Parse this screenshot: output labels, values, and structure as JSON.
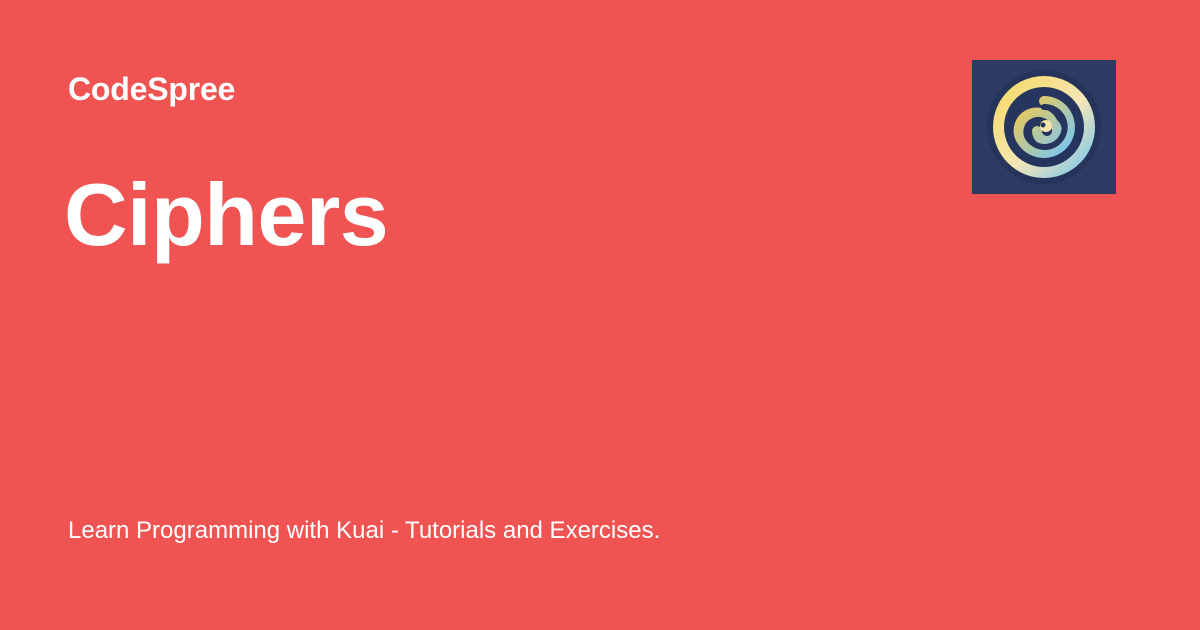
{
  "brand": {
    "name": "CodeSpree",
    "logo_icon": "spiral-logo-icon"
  },
  "page": {
    "title": "Ciphers",
    "tagline": "Learn Programming with Kuai - Tutorials and Exercises."
  },
  "colors": {
    "background": "#ef5453",
    "text": "#ffffff",
    "logo_background": "#2d3a63",
    "logo_yellow": "#f2c94c",
    "logo_blue": "#7fc8f8"
  }
}
